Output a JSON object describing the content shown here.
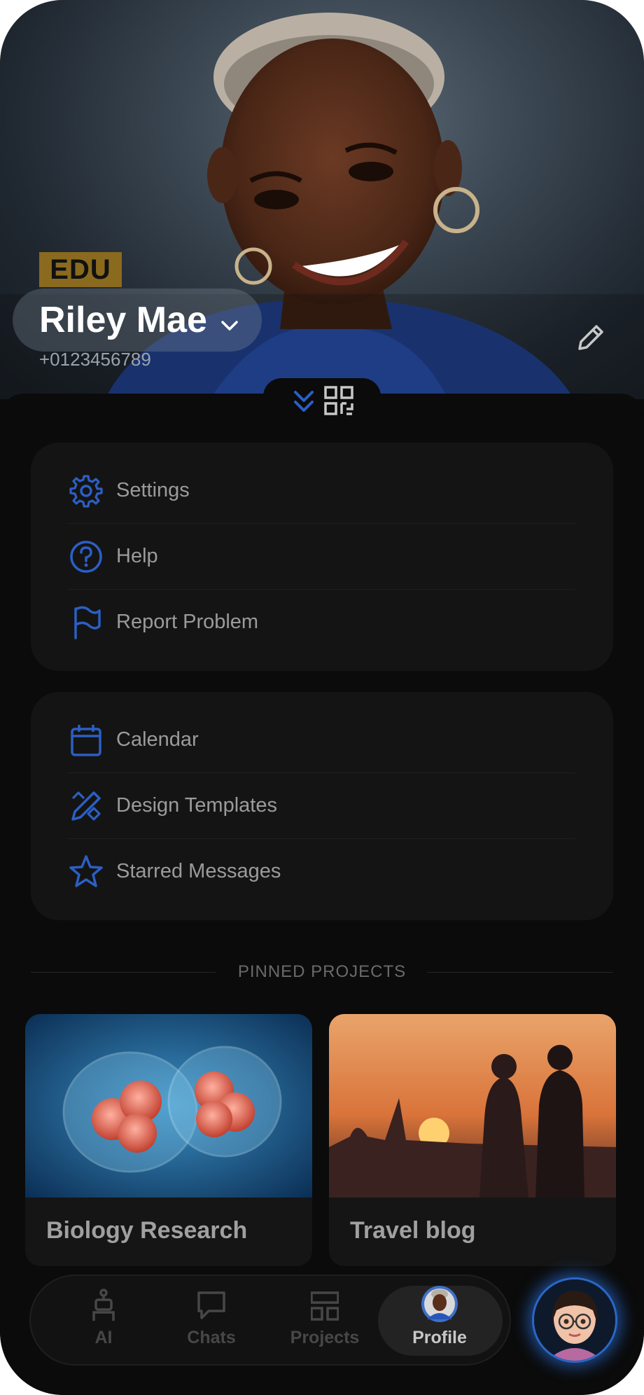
{
  "profile": {
    "badge": "EDU",
    "name": "Riley Mae",
    "phone": "+0123456789"
  },
  "menu_group_1": [
    {
      "label": "Settings",
      "icon": "gear-icon"
    },
    {
      "label": "Help",
      "icon": "help-circle-icon"
    },
    {
      "label": "Report Problem",
      "icon": "flag-icon"
    }
  ],
  "menu_group_2": [
    {
      "label": "Calendar",
      "icon": "calendar-icon"
    },
    {
      "label": "Design Templates",
      "icon": "design-pencil-icon"
    },
    {
      "label": "Starred Messages",
      "icon": "star-icon"
    }
  ],
  "pinned": {
    "title": "PINNED PROJECTS",
    "projects": [
      {
        "label": "Biology Research"
      },
      {
        "label": "Travel blog"
      }
    ]
  },
  "nav": {
    "items": [
      {
        "label": "AI",
        "icon": "robot-icon"
      },
      {
        "label": "Chats",
        "icon": "chat-bubble-icon"
      },
      {
        "label": "Projects",
        "icon": "projects-grid-icon"
      },
      {
        "label": "Profile",
        "icon": "avatar-icon"
      }
    ],
    "active": "Profile"
  },
  "colors": {
    "accent": "#2b5fc4",
    "badge": "#8a6a1e",
    "background": "#0b0b0b",
    "card": "#141414"
  }
}
